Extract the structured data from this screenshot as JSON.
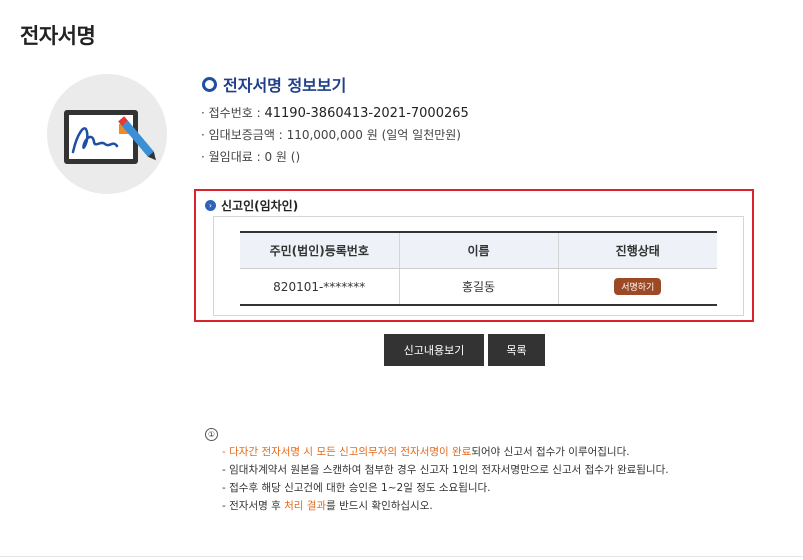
{
  "page": {
    "title": "전자서명"
  },
  "info": {
    "title": "전자서명 정보보기",
    "receipt_label": "· 접수번호 :",
    "receipt_value": "41190-3860413-2021-7000265",
    "deposit_label": "· 임대보증금액 :",
    "deposit_value": "110,000,000 원 (일억 일천만원)",
    "rent_label": "· 월임대료 :",
    "rent_value": "0 원 ()"
  },
  "reporter": {
    "section_title": "신고인(임차인)",
    "columns": [
      "주민(법인)등록번호",
      "이름",
      "진행상태"
    ],
    "rows": [
      {
        "id_number": "820101-*******",
        "name": "홍길동",
        "status": "서명하기"
      }
    ]
  },
  "buttons": {
    "view_report": "신고내용보기",
    "list": "목록"
  },
  "notice": {
    "icon": "①",
    "line1_hl": "- 다자간 전자서명 시 모든 신고의무자의 전자서명이 완료",
    "line1_rest": "되어야 신고서 접수가 이루어집니다.",
    "line2": "- 임대차계약서 원본을 스캔하여 첨부한 경우 신고자 1인의 전자서명만으로 신고서 접수가 완료됩니다.",
    "line3": "- 접수후 해당 신고건에 대한 승인은 1~2일 정도 소요됩니다.",
    "line4_a": "- 전자서명 후 ",
    "line4_hl": "처리 결과",
    "line4_b": "를 반드시 확인하십시오."
  },
  "colors": {
    "accent_red": "#d9232d",
    "header_blue": "#1f3f8a",
    "badge_brown": "#9c4a26",
    "highlight_orange": "#e46b1b"
  }
}
